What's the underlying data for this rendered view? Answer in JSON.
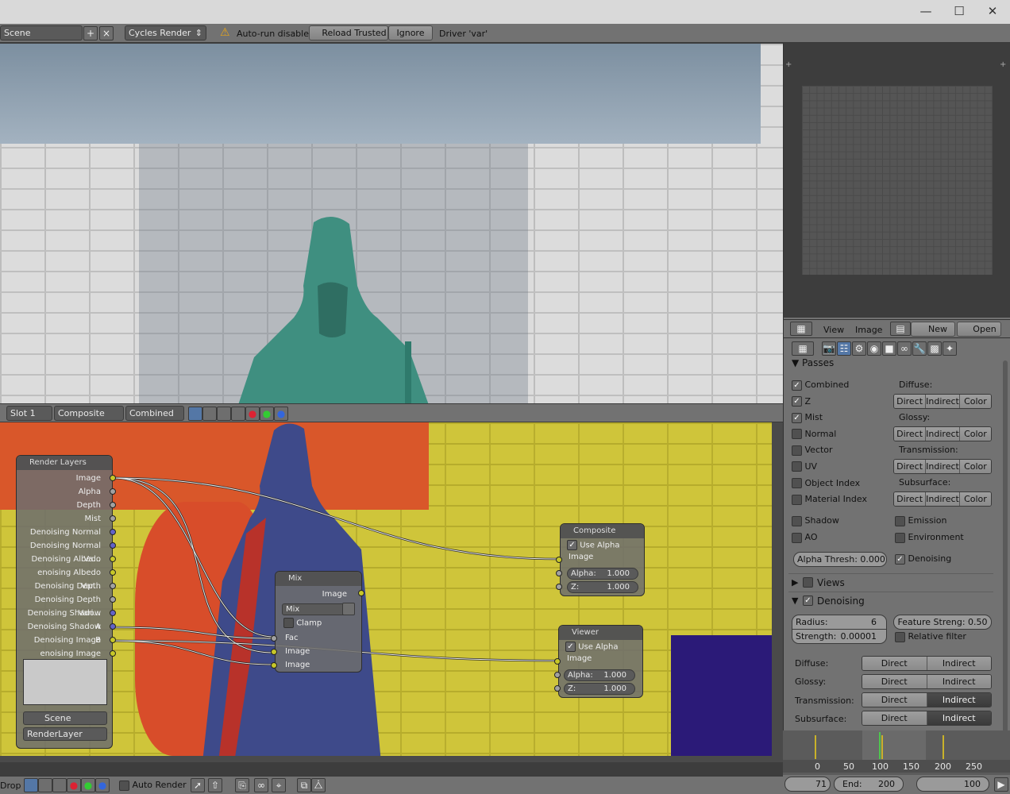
{
  "topbar": {
    "scene_field": "Scene",
    "engine": "Cycles Render",
    "warning": "Auto-run disabled",
    "reload": "Reload Trusted",
    "ignore": "Ignore",
    "driver": "Driver 'var'"
  },
  "nodebar": {
    "slot": "Slot 1",
    "composite": "Composite",
    "combined": "Combined"
  },
  "render_layers": {
    "title": "Render Layers",
    "outputs": [
      "Image",
      "Alpha",
      "Depth",
      "Mist",
      "Denoising Normal",
      "Denoising Normal Va...",
      "Denoising Albedo",
      "enoising Albedo Var...",
      "Denoising Depth",
      "Denoising Depth Vari...",
      "Denoising Shadow A",
      "Denoising Shadow B",
      "Denoising Image",
      "enoising Image Vari..."
    ],
    "scene": "Scene",
    "layer": "RenderLayer"
  },
  "mix": {
    "title": "Mix",
    "out": "Image",
    "mode": "Mix",
    "clamp": "Clamp",
    "fac": "Fac",
    "in1": "Image",
    "in2": "Image"
  },
  "composite": {
    "title": "Composite",
    "use_alpha": "Use Alpha",
    "image": "Image",
    "alpha_label": "Alpha:",
    "alpha_val": "1.000",
    "z_label": "Z:",
    "z_val": "1.000"
  },
  "viewer": {
    "title": "Viewer",
    "use_alpha": "Use Alpha",
    "image": "Image",
    "alpha_label": "Alpha:",
    "alpha_val": "1.000",
    "z_label": "Z:",
    "z_val": "1.000"
  },
  "bottombar": {
    "left": "Drop",
    "auto_render": "Auto Render"
  },
  "image_header": {
    "view": "View",
    "image": "Image",
    "new": "New",
    "open": "Open"
  },
  "passes": {
    "title": "Passes",
    "left": [
      {
        "label": "Combined",
        "on": true
      },
      {
        "label": "Z",
        "on": true
      },
      {
        "label": "Mist",
        "on": true
      },
      {
        "label": "Normal",
        "on": false
      },
      {
        "label": "Vector",
        "on": false
      },
      {
        "label": "UV",
        "on": false
      },
      {
        "label": "Object Index",
        "on": false
      },
      {
        "label": "Material Index",
        "on": false
      }
    ],
    "diffuse": "Diffuse:",
    "glossy": "Glossy:",
    "transmission": "Transmission:",
    "subsurface": "Subsurface:",
    "direct": "Direct",
    "indirect": "Indirect",
    "color": "Color",
    "shadow": "Shadow",
    "ao": "AO",
    "emission": "Emission",
    "environment": "Environment",
    "alpha_thresh": "Alpha Thresh: 0.000",
    "denoising": "Denoising"
  },
  "views_title": "Views",
  "denoising": {
    "title": "Denoising",
    "radius_label": "Radius:",
    "radius_val": "6",
    "strength_label": "Strength:",
    "strength_val": "0.00001",
    "feature": "Feature Streng: 0.50",
    "relative": "Relative filter",
    "rows": [
      {
        "label": "Diffuse:",
        "direct_sel": false,
        "indirect_sel": false
      },
      {
        "label": "Glossy:",
        "direct_sel": false,
        "indirect_sel": false
      },
      {
        "label": "Transmission:",
        "direct_sel": false,
        "indirect_sel": true
      },
      {
        "label": "Subsurface:",
        "direct_sel": false,
        "indirect_sel": true
      }
    ],
    "direct": "Direct",
    "indirect": "Indirect"
  },
  "timeline": {
    "ticks": [
      "0",
      "50",
      "100",
      "150",
      "200",
      "250"
    ],
    "current": "71",
    "end": "End:",
    "end_val": "200",
    "last": "100"
  }
}
